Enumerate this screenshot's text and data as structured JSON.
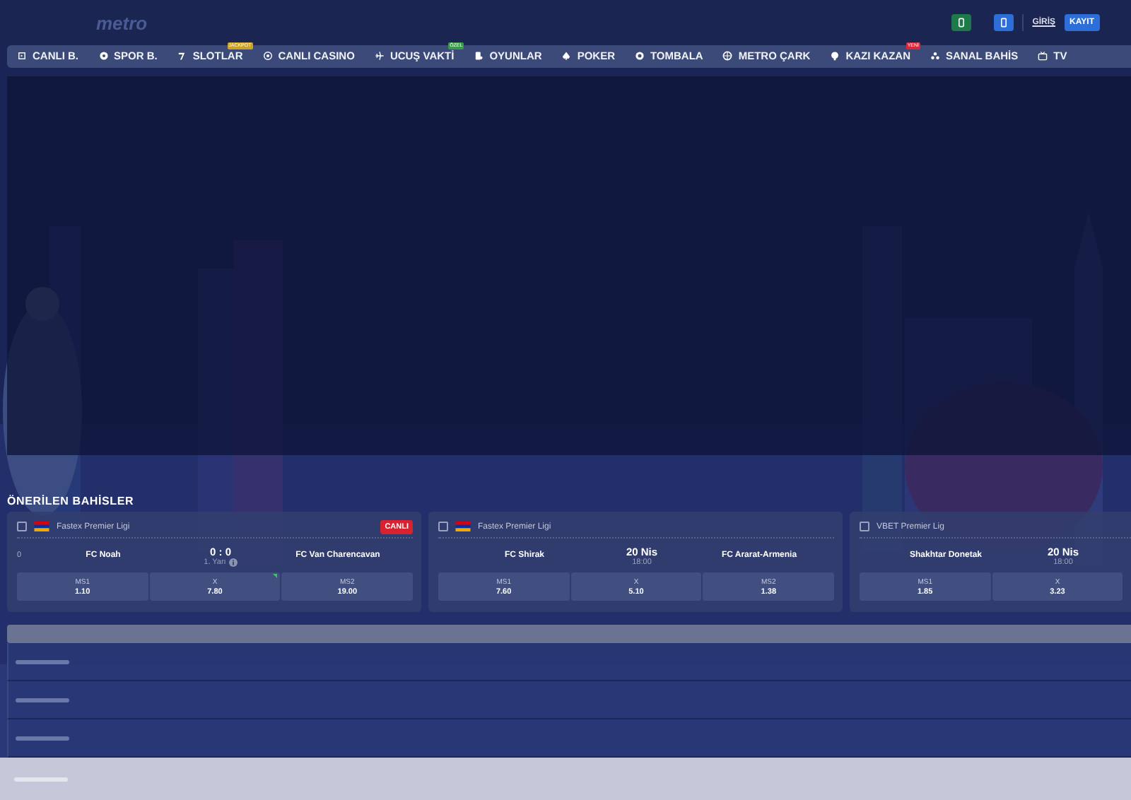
{
  "header": {
    "logo": "metro",
    "login": "GİRİŞ",
    "register": "KAYIT"
  },
  "nav": [
    {
      "label": "CANLI B.",
      "kind": "live"
    },
    {
      "label": "SPOR B.",
      "kind": "ball"
    },
    {
      "label": "SLOTLAR",
      "kind": "seven",
      "badge": {
        "text": "JACKPOT",
        "color": "#c9a227"
      }
    },
    {
      "label": "CANLI CASINO",
      "kind": "chip"
    },
    {
      "label": "UCUŞ VAKTİ",
      "kind": "plane",
      "badge": {
        "text": "ÖZEL",
        "color": "#3a9a4a"
      }
    },
    {
      "label": "OYUNLAR",
      "kind": "game"
    },
    {
      "label": "POKER",
      "kind": "spade"
    },
    {
      "label": "TOMBALA",
      "kind": "bingo"
    },
    {
      "label": "METRO ÇARK",
      "kind": "wheel"
    },
    {
      "label": "KAZI KAZAN",
      "kind": "scratch",
      "badge": {
        "text": "YENİ",
        "color": "#d8283a"
      }
    },
    {
      "label": "SANAL BAHİS",
      "kind": "virtual"
    },
    {
      "label": "TV",
      "kind": "tv"
    }
  ],
  "section_title": "ÖNERİLEN BAHİSLER",
  "cards": [
    {
      "checked": false,
      "league": "Fastex Premier Ligi",
      "flag": true,
      "live": "CANLI",
      "side_count": "0",
      "home": "FC Noah",
      "away": "FC Van Charencavan",
      "center": "0 : 0",
      "center_sub": "1. Yarı",
      "info": true,
      "odds": [
        {
          "label": "MS1",
          "value": "1.10",
          "rising": false
        },
        {
          "label": "X",
          "value": "7.80",
          "rising": true
        },
        {
          "label": "MS2",
          "value": "19.00",
          "rising": false
        }
      ]
    },
    {
      "checked": false,
      "league": "Fastex Premier Ligi",
      "flag": true,
      "home": "FC Shirak",
      "away": "FC Ararat-Armenia",
      "center": "20 Nis",
      "center_sub": "18:00",
      "odds": [
        {
          "label": "MS1",
          "value": "7.60",
          "rising": false
        },
        {
          "label": "X",
          "value": "5.10",
          "rising": false
        },
        {
          "label": "MS2",
          "value": "1.38",
          "rising": false
        }
      ]
    },
    {
      "checked": false,
      "league": "VBET Premier Lig",
      "home": "Shakhtar Donetak",
      "center": "20 Nis",
      "center_sub": "18:00",
      "odds": [
        {
          "label": "MS1",
          "value": "1.85",
          "rising": false
        },
        {
          "label": "X",
          "value": "3.23",
          "rising": false
        }
      ]
    }
  ]
}
